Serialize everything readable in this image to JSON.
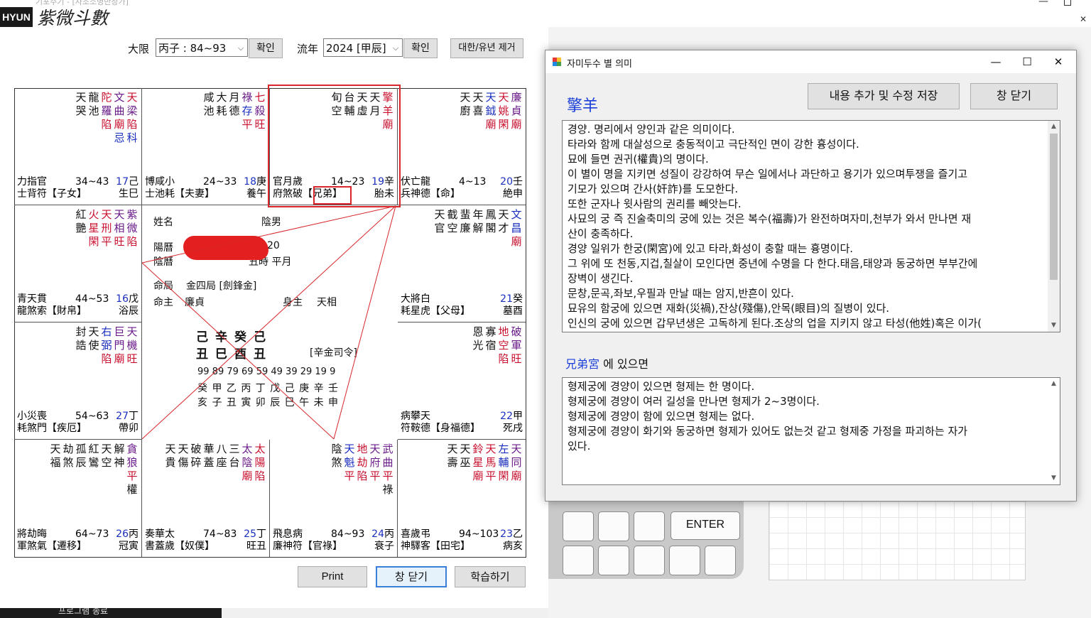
{
  "window": {
    "caption_faint": "기포주기 - [사조소명반장가]",
    "logo_box": "HYUN",
    "logo_text": "紫微斗數"
  },
  "toolbar": {
    "daehan_label": "大限",
    "daehan_value": "丙子 : 84~93",
    "confirm1": "확인",
    "yunyear_label": "流年",
    "yunyear_value": "2024 [甲辰]",
    "confirm2": "확인",
    "remove_btn": "대한/유년 제거"
  },
  "palaces": [
    {
      "stars": [
        [
          "天",
          "龍",
          "陀",
          "文",
          "天"
        ],
        [
          "哭",
          "池",
          "羅",
          "曲",
          "梁"
        ]
      ],
      "colors": [
        [
          "black",
          "black",
          "red",
          "purple",
          "red"
        ],
        [
          "black",
          "black",
          "purple",
          "purple",
          "purple"
        ]
      ],
      "status": [
        [
          "",
          "",
          "陷",
          "廟",
          "陷"
        ],
        [
          "",
          "",
          "",
          "忌",
          "科"
        ]
      ],
      "scolors": [
        [
          "",
          "",
          "red",
          "red",
          "red"
        ],
        [
          "",
          "",
          "",
          "blue",
          "blue"
        ]
      ],
      "b1": [
        "力",
        "指",
        "官",
        "34~43",
        "17",
        "己"
      ],
      "b2": [
        "士",
        "背",
        "符【子女】",
        "",
        "生",
        "巳"
      ]
    },
    {
      "stars": [
        [
          "咸",
          "大",
          "月",
          "祿",
          "七"
        ],
        [
          "池",
          "耗",
          "德",
          "存",
          "殺"
        ]
      ],
      "colors": [
        [
          "black",
          "black",
          "black",
          "purple",
          "red"
        ],
        [
          "black",
          "black",
          "black",
          "blue",
          "purple"
        ]
      ],
      "status": [
        [
          "",
          "",
          "",
          "平",
          "旺"
        ]
      ],
      "scolors": [
        [
          "",
          "",
          "",
          "red",
          "red"
        ]
      ],
      "b1": [
        "博",
        "咸",
        "小",
        "24~33",
        "18",
        "庚"
      ],
      "b2": [
        "士",
        "池",
        "耗【夫妻】",
        "",
        "養",
        "午"
      ]
    },
    {
      "stars": [
        [
          "旬",
          "台",
          "天",
          "天",
          "擎"
        ],
        [
          "空",
          "輔",
          "虛",
          "月",
          "羊"
        ]
      ],
      "colors": [
        [
          "black",
          "black",
          "black",
          "black",
          "red"
        ],
        [
          "black",
          "black",
          "black",
          "black",
          "red"
        ]
      ],
      "status": [
        [
          "",
          "",
          "",
          "",
          "廟"
        ]
      ],
      "scolors": [
        [
          "",
          "",
          "",
          "",
          "red"
        ]
      ],
      "b1": [
        "官",
        "月",
        "歲",
        "14~23",
        "19",
        "辛"
      ],
      "b2": [
        "府",
        "煞",
        "破【兄弟】",
        "",
        "胎",
        "未"
      ]
    },
    {
      "stars": [
        [
          "天",
          "天",
          "天",
          "天",
          "廉"
        ],
        [
          "廚",
          "喜",
          "鉞",
          "姚",
          "貞"
        ]
      ],
      "colors": [
        [
          "black",
          "black",
          "blue",
          "red",
          "purple"
        ],
        [
          "black",
          "black",
          "blue",
          "red",
          "purple"
        ]
      ],
      "status": [
        [
          "",
          "",
          "廟",
          "閑",
          "廟"
        ]
      ],
      "scolors": [
        [
          "",
          "",
          "red",
          "red",
          "red"
        ]
      ],
      "b1": [
        "伏",
        "亡",
        "龍",
        "4~13",
        "20",
        "壬"
      ],
      "b2": [
        "兵",
        "神",
        "德【命】",
        "",
        "絶",
        "申"
      ]
    },
    {
      "stars": [
        [
          "紅",
          "火",
          "天",
          "天",
          "紫"
        ],
        [
          "艷",
          "星",
          "刑",
          "相",
          "微"
        ]
      ],
      "colors": [
        [
          "black",
          "red",
          "red",
          "purple",
          "purple"
        ],
        [
          "black",
          "red",
          "red",
          "purple",
          "purple"
        ]
      ],
      "status": [
        [
          "",
          "閑",
          "平",
          "旺",
          "陷"
        ]
      ],
      "scolors": [
        [
          "",
          "red",
          "red",
          "red",
          "red"
        ]
      ],
      "b1": [
        "青",
        "天",
        "貫",
        "44~53",
        "16",
        "戊"
      ],
      "b2": [
        "龍",
        "煞",
        "索【財帛】",
        "",
        "浴",
        "辰"
      ]
    },
    {
      "stars": [
        [
          "天",
          "截",
          "蜚",
          "年",
          "鳳",
          "天",
          "文"
        ],
        [
          "官",
          "空",
          "廉",
          "解",
          "閣",
          "才",
          "昌"
        ]
      ],
      "colors": [
        [
          "black",
          "black",
          "black",
          "black",
          "black",
          "black",
          "blue"
        ],
        [
          "black",
          "black",
          "black",
          "black",
          "black",
          "black",
          "blue"
        ]
      ],
      "status": [
        [
          "",
          "",
          "",
          "",
          "",
          "",
          "廟"
        ]
      ],
      "scolors": [
        [
          "",
          "",
          "",
          "",
          "",
          "",
          "red"
        ]
      ],
      "b1": [
        "大",
        "將",
        "白",
        "",
        "21",
        "癸"
      ],
      "b2": [
        "耗",
        "星",
        "虎【父母】",
        "",
        "墓",
        "酉"
      ]
    },
    {
      "stars": [
        [
          "封",
          "天",
          "右",
          "巨",
          "天"
        ],
        [
          "誥",
          "使",
          "弼",
          "門",
          "機"
        ]
      ],
      "colors": [
        [
          "black",
          "black",
          "blue",
          "purple",
          "purple"
        ],
        [
          "black",
          "black",
          "blue",
          "purple",
          "purple"
        ]
      ],
      "status": [
        [
          "",
          "",
          "陷",
          "廟",
          "旺"
        ]
      ],
      "scolors": [
        [
          "",
          "",
          "red",
          "red",
          "red"
        ]
      ],
      "b1": [
        "小",
        "災",
        "喪",
        "54~63",
        "27",
        "丁"
      ],
      "b2": [
        "耗",
        "煞",
        "門【疾厄】",
        "",
        "帶",
        "卯"
      ]
    },
    {
      "stars": [
        [
          "恩",
          "寡",
          "地",
          "破"
        ],
        [
          "光",
          "宿",
          "空",
          "軍"
        ]
      ],
      "colors": [
        [
          "black",
          "black",
          "red",
          "purple"
        ],
        [
          "black",
          "black",
          "red",
          "purple"
        ]
      ],
      "status": [
        [
          "",
          "",
          "陷",
          "旺"
        ]
      ],
      "scolors": [
        [
          "",
          "",
          "red",
          "red"
        ]
      ],
      "b1": [
        "病",
        "攀",
        "天",
        "",
        "22",
        "甲"
      ],
      "b2": [
        "符",
        "鞍",
        "德【身福德】",
        "",
        "死",
        "戌"
      ]
    },
    {
      "stars": [
        [
          "天",
          "劫",
          "孤",
          "紅",
          "天",
          "解",
          "貪"
        ],
        [
          "福",
          "煞",
          "辰",
          "鸞",
          "空",
          "神",
          "狼"
        ]
      ],
      "colors": [
        [
          "black",
          "black",
          "black",
          "black",
          "black",
          "black",
          "purple"
        ],
        [
          "black",
          "black",
          "black",
          "black",
          "black",
          "black",
          "purple"
        ]
      ],
      "status": [
        [
          "",
          "",
          "",
          "",
          "",
          "",
          "平"
        ],
        [
          "",
          "",
          "",
          "",
          "",
          "",
          "權"
        ]
      ],
      "scolors": [
        [
          "",
          "",
          "",
          "",
          "",
          "",
          "red"
        ],
        [
          "",
          "",
          "",
          "",
          "",
          "",
          "black"
        ]
      ],
      "b1": [
        "將",
        "劫",
        "晦",
        "64~73",
        "26",
        "丙"
      ],
      "b2": [
        "軍",
        "煞",
        "氣【遷移】",
        "",
        "冠",
        "寅"
      ]
    },
    {
      "stars": [
        [
          "天",
          "天",
          "破",
          "華",
          "八",
          "三",
          "太",
          "太"
        ],
        [
          "貴",
          "傷",
          "碎",
          "蓋",
          "座",
          "台",
          "陰",
          "陽"
        ]
      ],
      "colors": [
        [
          "black",
          "black",
          "black",
          "black",
          "black",
          "black",
          "purple",
          "red"
        ],
        [
          "black",
          "black",
          "black",
          "black",
          "black",
          "black",
          "purple",
          "red"
        ]
      ],
      "status": [
        [
          "",
          "",
          "",
          "",
          "",
          "",
          "廟",
          "陷"
        ]
      ],
      "scolors": [
        [
          "",
          "",
          "",
          "",
          "",
          "",
          "red",
          "red"
        ]
      ],
      "b1": [
        "奏",
        "華",
        "太",
        "74~83",
        "25",
        "丁"
      ],
      "b2": [
        "書",
        "蓋",
        "歲【奴僕】",
        "",
        "旺",
        "丑"
      ]
    },
    {
      "stars": [
        [
          "陰",
          "天",
          "地",
          "天",
          "武"
        ],
        [
          "煞",
          "魁",
          "劫",
          "府",
          "曲"
        ]
      ],
      "colors": [
        [
          "black",
          "blue",
          "red",
          "purple",
          "purple"
        ],
        [
          "black",
          "blue",
          "red",
          "purple",
          "purple"
        ]
      ],
      "status": [
        [
          "",
          "",
          "平",
          "陷",
          "平",
          "平"
        ],
        [
          "",
          "",
          "",
          "",
          "",
          "祿"
        ]
      ],
      "scolors": [
        [
          "",
          "",
          "red",
          "red",
          "red",
          "red"
        ],
        [
          "",
          "",
          "",
          "",
          "",
          "black"
        ]
      ],
      "b1": [
        "飛",
        "息",
        "病",
        "84~93",
        "24",
        "丙"
      ],
      "b2": [
        "廉",
        "神",
        "符【官祿】",
        "",
        "衰",
        "子"
      ]
    },
    {
      "stars": [
        [
          "天",
          "天",
          "鈴",
          "天",
          "左",
          "天"
        ],
        [
          "壽",
          "巫",
          "星",
          "馬",
          "輔",
          "同"
        ]
      ],
      "colors": [
        [
          "black",
          "black",
          "red",
          "red",
          "blue",
          "purple"
        ],
        [
          "black",
          "black",
          "red",
          "red",
          "blue",
          "purple"
        ]
      ],
      "status": [
        [
          "",
          "",
          "廟",
          "平",
          "閑",
          "廟"
        ]
      ],
      "scolors": [
        [
          "",
          "",
          "red",
          "red",
          "red",
          "red"
        ]
      ],
      "b1": [
        "喜",
        "歲",
        "弔",
        "94~103",
        "23",
        "乙"
      ],
      "b2": [
        "神",
        "驛",
        "客【田宅】",
        "",
        "病",
        "亥"
      ]
    }
  ],
  "center": {
    "name_label": "姓名",
    "gender": "陰男",
    "solar_label": "陽曆",
    "solar_value": "20",
    "lunar_label": "陰曆",
    "lunar_value": "丑時  平月",
    "ju_label": "命局",
    "ju_value": "金四局 [劍鋒金]",
    "mingzhu_label": "命主",
    "mingzhu_value": "廉貞",
    "shenzhu_label": "身主",
    "shenzhu_value": "天相",
    "stems": "己辛癸己",
    "branches": "丑巳酉丑",
    "siling": "[辛金司令]",
    "ages": "99 89 79 69 59 49 39 29 19 9",
    "luck_stems": "癸 甲 乙 丙 丁 戊 己 庚 辛 壬",
    "luck_branches": "亥 子 丑 寅 卯 辰 巳 午 未 申"
  },
  "bottom_buttons": {
    "print": "Print",
    "close": "창 닫기",
    "learn": "학습하기"
  },
  "taskbar_text": "프로그램 종료",
  "dialog": {
    "title": "자미두수 별 의미",
    "star": "擎羊",
    "save_btn": "내용 추가 및 수정 저장",
    "close_btn": "창 닫기",
    "meaning_lines": [
      "경양. 명리에서 양인과 같은 의미이다.",
      "타라와 함께 대살성으로 충동적이고 극단적인 면이 강한 흉성이다.",
      "묘에 들면 권귀(權貴)의 명이다.",
      "이 별이 명을 지키면 성질이 강강하여 무슨 일에서나 과단하고 용기가 있으며투쟁을 즐기고",
      "기모가 있으며 간사(奸詐)를 도모한다.",
      "또한 군자나 윗사람의 권리를 빼앗는다.",
      "사묘의 궁 즉 진술축미의 궁에 있는 것은 복수(福壽)가 완전하며자미,천부가 와서 만나면 재",
      "산이 충족하다.",
      "경양 일위가 한궁(閑宮)에 있고 타라,화성이 충할 때는 흉명이다.",
      "그 위에 또 천동,지겁,칠살이 모인다면 중년에 수명을 다 한다.태음,태양과 동궁하면 부부간에",
      "장벽이 생긴다.",
      "문창,문곡,좌보,우필과 만날 때는 암지,반흔이 있다.",
      "묘유의 함궁에 있으면 재화(災禍),잔상(殘傷),안목(眼目)의 질병이 있다.",
      "인신의 궁에 있으면 갑무년생은 고독하게 된다.조상의 업을 지키지 않고 타성(他姓)혹은 이가("
    ],
    "palace_name": "兄弟宮",
    "palace_suffix": " 에 있으면",
    "palace_lines": [
      "형제궁에 경양이 있으면 형제는 한 명이다.",
      "형제궁에 경양이 여러 길성을 만나면 형제가 2~3명이다.",
      "형제궁에 경양이 함에 있으면 형제는 없다.",
      "형제궁에 경양이 화기와 동궁하면 형제가 있어도 없는것 같고 형제중 가정을 파괴하는 자가",
      "있다."
    ]
  },
  "background_app": {
    "enter_key": "ENTER"
  },
  "colors": {
    "red": "#c8102e",
    "blue": "#1a2fbf",
    "purple": "#6a1b8a",
    "highlight": "#d9262a",
    "star_title": "#1a3fd8"
  }
}
